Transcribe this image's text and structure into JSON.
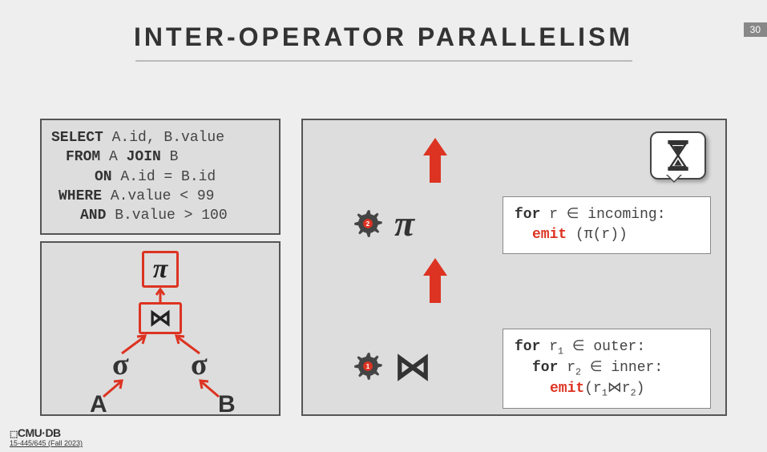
{
  "page_number": "30",
  "title": "INTER-OPERATOR PARALLELISM",
  "sql": {
    "select_kw": "SELECT",
    "select_cols": " A.id, B.value",
    "from_kw": "FROM",
    "from_body": " A ",
    "join_kw": "JOIN",
    "join_body": " B",
    "on_kw": "ON",
    "on_body": " A.id = B.id",
    "where_kw": "WHERE",
    "where_body": " A.value < 99",
    "and_kw": "AND",
    "and_body": " B.value > 100"
  },
  "tree": {
    "pi": "π",
    "join": "⋈",
    "sigma": "σ",
    "A": "A",
    "B": "B"
  },
  "right": {
    "pi_sym": "π",
    "join_sym": "⋈",
    "gear_label_1": "1",
    "gear_label_2": "2",
    "code_pi_l1a": "for",
    "code_pi_l1b": " r ∈ incoming:",
    "code_pi_l2a": "emit",
    "code_pi_l2b": " (π(r))",
    "code_join_l1a": "for",
    "code_join_l1b": " r",
    "code_join_l1c": " ∈ outer:",
    "code_join_l2a": "for",
    "code_join_l2b": " r",
    "code_join_l2c": " ∈ inner:",
    "code_join_l3a": "emit",
    "code_join_l3b": "(r",
    "code_join_l3c": "⋈r",
    "code_join_l3d": ")",
    "sub1": "1",
    "sub2": "2"
  },
  "footer": {
    "brand": "CMU·DB",
    "course": "15-445/645 (Fall 2023)"
  }
}
